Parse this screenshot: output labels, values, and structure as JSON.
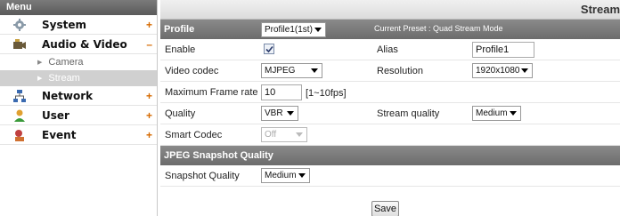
{
  "sidebar": {
    "header": "Menu",
    "items": [
      {
        "label": "System",
        "toggle": "+"
      },
      {
        "label": "Audio & Video",
        "toggle": "–"
      },
      {
        "label": "Network",
        "toggle": "+"
      },
      {
        "label": "User",
        "toggle": "+"
      },
      {
        "label": "Event",
        "toggle": "+"
      }
    ],
    "subitems": [
      {
        "label": "Camera"
      },
      {
        "label": "Stream"
      }
    ]
  },
  "page_title": "Stream",
  "profile": {
    "label": "Profile",
    "value": "Profile1(1st)",
    "preset_text": "Current Preset : Quad Stream Mode"
  },
  "form": {
    "enable_label": "Enable",
    "alias_label": "Alias",
    "alias_value": "Profile1",
    "video_codec_label": "Video codec",
    "video_codec_value": "MJPEG",
    "resolution_label": "Resolution",
    "resolution_value": "1920x1080",
    "max_frame_label": "Maximum Frame rate",
    "max_frame_value": "10",
    "max_frame_hint": "[1~10fps]",
    "quality_label": "Quality",
    "quality_value": "VBR",
    "stream_quality_label": "Stream quality",
    "stream_quality_value": "Medium",
    "smart_codec_label": "Smart Codec",
    "smart_codec_value": "Off"
  },
  "jpeg": {
    "header": "JPEG Snapshot Quality",
    "snapshot_label": "Snapshot Quality",
    "snapshot_value": "Medium"
  },
  "save_label": "Save",
  "colors": {
    "accent": "#d66a00",
    "header_gray": "#6c6c6c"
  }
}
